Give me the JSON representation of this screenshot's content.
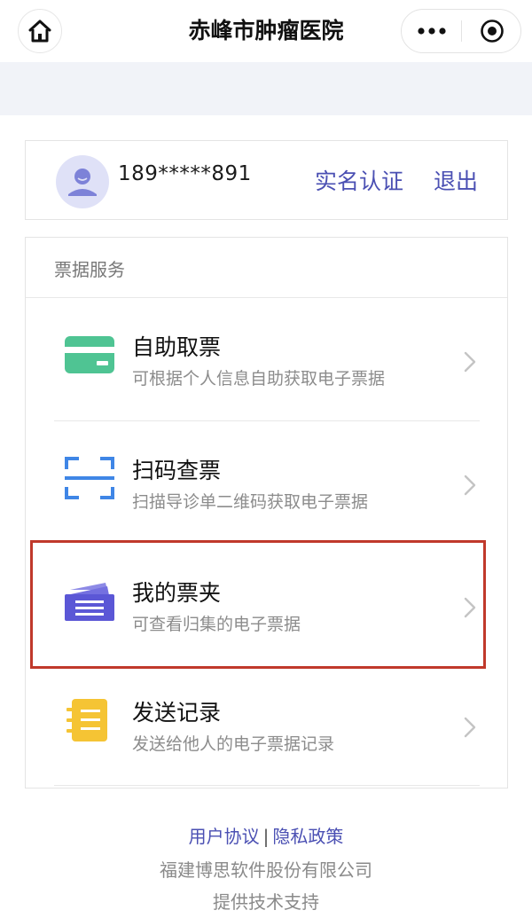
{
  "navbar": {
    "title": "赤峰市肿瘤医院",
    "home_icon": "home-icon",
    "more_icon": "more-dots-icon",
    "close_icon": "record-close-icon"
  },
  "user": {
    "phone": "189*****891",
    "verify_label": "实名认证",
    "logout_label": "退出",
    "avatar_icon": "user-avatar-icon"
  },
  "services": {
    "title": "票据服务",
    "items": [
      {
        "title": "自助取票",
        "desc": "可根据个人信息自助获取电子票据",
        "icon": "card-icon",
        "color": "#4fc493"
      },
      {
        "title": "扫码查票",
        "desc": "扫描导诊单二维码获取电子票据",
        "icon": "scan-icon",
        "color": "#3f86e6"
      },
      {
        "title": "我的票夹",
        "desc": "可查看归集的电子票据",
        "icon": "ticket-folder-icon",
        "color": "#5b57d6"
      },
      {
        "title": "发送记录",
        "desc": "发送给他人的电子票据记录",
        "icon": "send-record-icon",
        "color": "#f5c434"
      }
    ]
  },
  "footer": {
    "user_agreement": "用户协议",
    "separator": "|",
    "privacy_policy": "隐私政策",
    "company": "福建博思软件股份有限公司",
    "support": "提供技术支持"
  },
  "colors": {
    "accent": "#4b50b3",
    "highlight": "#c0392b",
    "band": "#f1f3f8"
  }
}
